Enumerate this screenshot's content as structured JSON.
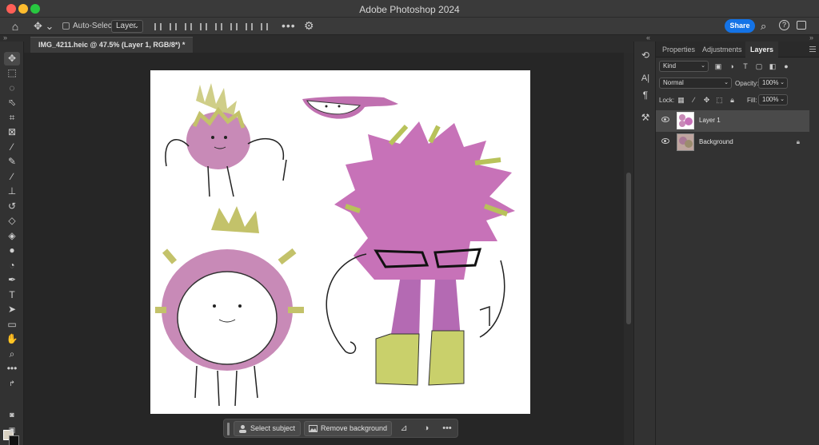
{
  "window": {
    "title": "Adobe Photoshop 2024"
  },
  "options_bar": {
    "auto_select_label": "Auto-Select:",
    "auto_select_value": "Layer",
    "more_label": "•••",
    "share_label": "Share"
  },
  "document": {
    "tab_label": "IMG_4211.heic @ 47.5% (Layer 1, RGB/8*) *"
  },
  "colors": {
    "foreground": "#d9d1c2",
    "background": "#111111",
    "accent": "#1473e6"
  },
  "tools": [
    "move-tool",
    "marquee-tool",
    "lasso-tool",
    "object-selection-tool",
    "crop-tool",
    "frame-tool",
    "eyedropper-tool",
    "spot-healing-tool",
    "brush-tool",
    "clone-stamp-tool",
    "history-brush-tool",
    "eraser-tool",
    "paint-bucket-tool",
    "blur-tool",
    "dodge-tool",
    "pen-tool",
    "type-tool",
    "path-selection-tool",
    "rectangle-tool",
    "hand-tool",
    "zoom-tool",
    "edit-toolbar"
  ],
  "contextual_taskbar": {
    "select_subject_label": "Select subject",
    "remove_background_label": "Remove background"
  },
  "panels": {
    "tabs": [
      "Properties",
      "Adjustments",
      "Layers"
    ],
    "active_tab": "Layers",
    "filter_kind": "Kind",
    "blend_mode": "Normal",
    "opacity_label": "Opacity:",
    "opacity_value": "100%",
    "lock_label": "Lock:",
    "fill_label": "Fill:",
    "fill_value": "100%",
    "layers": [
      {
        "name": "Layer 1",
        "selected": true,
        "locked": false
      },
      {
        "name": "Background",
        "selected": false,
        "locked": true
      }
    ]
  }
}
